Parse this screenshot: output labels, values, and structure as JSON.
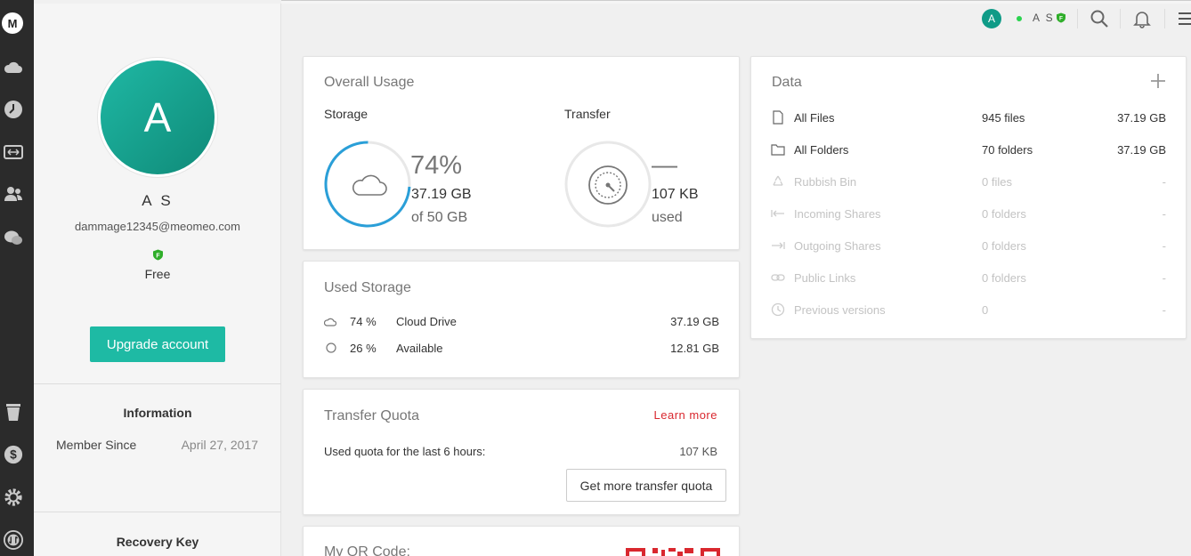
{
  "sidebar_rail": {
    "logo": "M",
    "icons": [
      "cloud-drive-icon",
      "recents-icon",
      "transfers-icon",
      "contacts-icon",
      "chat-icon",
      "rubbish-bin-icon",
      "pro-dollar-icon",
      "settings-icon",
      "sync-icon"
    ]
  },
  "profile": {
    "avatar_letter": "A",
    "name": "A S",
    "email": "dammage12345@meomeo.com",
    "plan_badge_letter": "F",
    "plan": "Free",
    "upgrade_label": "Upgrade account",
    "info_title": "Information",
    "member_since_label": "Member Since",
    "member_since_value": "April 27, 2017",
    "recovery_key_title": "Recovery Key"
  },
  "topbar": {
    "avatar_letter": "A",
    "user_name": "A S",
    "badge_letter": "F",
    "online_color": "#2bd34f",
    "icons": [
      "search-icon",
      "bell-icon",
      "menu-icon"
    ]
  },
  "overall_usage": {
    "title": "Overall Usage",
    "storage_label": "Storage",
    "storage_percent_text": "74%",
    "storage_percent": 74,
    "storage_used": "37.19 GB",
    "storage_total": "of 50 GB",
    "transfer_label": "Transfer",
    "transfer_percent_text": "—",
    "transfer_used": "107 KB",
    "transfer_used_suffix": "used"
  },
  "used_storage": {
    "title": "Used Storage",
    "rows": [
      {
        "pct": "74 %",
        "label": "Cloud Drive",
        "size": "37.19 GB",
        "icon": "cloud-icon"
      },
      {
        "pct": "26 %",
        "label": "Available",
        "size": "12.81 GB",
        "icon": "circle-icon"
      }
    ]
  },
  "transfer_quota": {
    "title": "Transfer Quota",
    "learn_more": "Learn more",
    "used_text": "Used quota for the last 6 hours:",
    "used_value": "107 KB",
    "button": "Get more transfer quota"
  },
  "qr": {
    "title": "My QR Code:"
  },
  "data": {
    "title": "Data",
    "rows": [
      {
        "label": "All Files",
        "count": "945 files",
        "size": "37.19 GB",
        "icon": "file-icon",
        "active": true
      },
      {
        "label": "All Folders",
        "count": "70 folders",
        "size": "37.19 GB",
        "icon": "folder-icon",
        "active": true
      },
      {
        "label": "Rubbish Bin",
        "count": "0 files",
        "size": "-",
        "icon": "recycle-icon",
        "active": false
      },
      {
        "label": "Incoming Shares",
        "count": "0 folders",
        "size": "-",
        "icon": "incoming-arrow-icon",
        "active": false
      },
      {
        "label": "Outgoing Shares",
        "count": "0 folders",
        "size": "-",
        "icon": "outgoing-arrow-icon",
        "active": false
      },
      {
        "label": "Public Links",
        "count": "0 folders",
        "size": "-",
        "icon": "link-icon",
        "active": false
      },
      {
        "label": "Previous versions",
        "count": "0",
        "size": "-",
        "icon": "clock-icon",
        "active": false
      }
    ]
  },
  "colors": {
    "accent": "#1ebaa4",
    "storage_ring": "#2a9fd8",
    "learn_more": "#d9272e",
    "rail_bg": "#2b2b2b"
  }
}
